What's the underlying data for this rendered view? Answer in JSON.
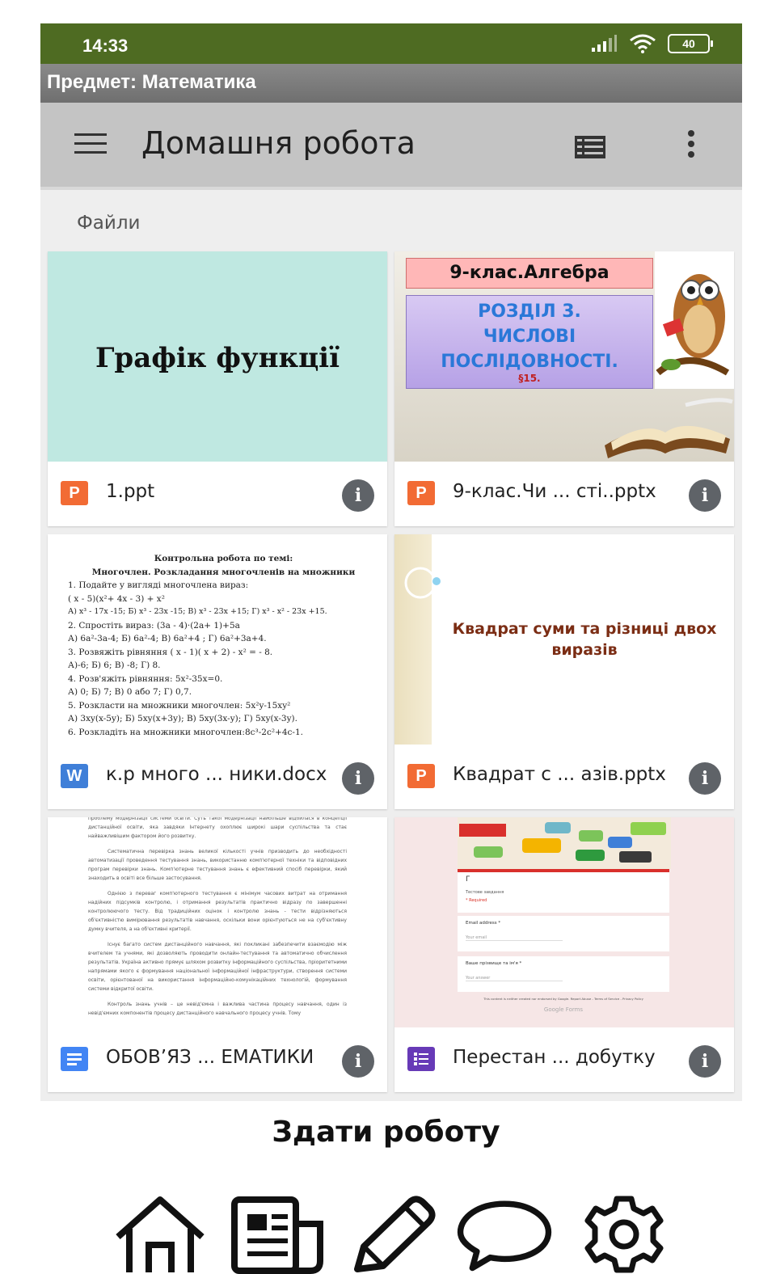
{
  "status": {
    "time": "14:33",
    "battery": "40"
  },
  "subject": "Предмет: Математика",
  "appbar": {
    "title": "Домашня робота"
  },
  "section_label": "Файли",
  "files": [
    {
      "name": "1.ppt",
      "type": "P",
      "thumb_title": "Графік функції"
    },
    {
      "name": "9-клас.Чи ... сті..pptx",
      "type": "P",
      "thumb_banner": "9-клас.Алгебра",
      "thumb_lines": [
        "РОЗДІЛ 3.",
        "ЧИСЛОВІ",
        "ПОСЛІДОВНОСТІ."
      ],
      "thumb_par": "§15."
    },
    {
      "name": "к.р много ... ники.docx",
      "type": "W",
      "thumb_heading1": "Контрольна робота по темі:",
      "thumb_heading2": "Многочлен. Розкладання многочленів на множники",
      "thumb_lines": [
        "1. Подайте у вигляді многочлена вираз:",
        "( x - 5)(x²+ 4x - 3) + x²",
        "А) x³ - 17x -15; Б) x³ - 23x -15;  В) x³ - 23x +15; Г) x³ - x² - 23x +15.",
        "2. Спростіть вираз: (3a - 4)·(2a+ 1)+5a",
        "А) 6a²-3a-4; Б) 6a²-4;  В) 6a²+4 ;  Г) 6a²+3a+4.",
        "3. Розвяжіть рівняння ( x - 1)( x + 2) - x² = - 8.",
        "А)-6;   Б) 6;  В)  -8;  Г) 8.",
        "4. Розв'яжіть рівняння:  5x²-35x=0.",
        "А) 0;  Б)  7;  В)  0 або 7;   Г) 0,7.",
        "5. Розкласти на множники многочлен: 5x²y-15xy²",
        "А)  3xy(x-5y); Б) 5xy(x+3y); В) 5xy(3x-y); Г) 5xy(x-3y).",
        "6. Розкладіть на множники многочлен:8c³-2c²+4c-1."
      ]
    },
    {
      "name": "Квадрат с ... азів.pptx",
      "type": "P",
      "thumb_title": "Квадрат суми та різниці двох виразів"
    },
    {
      "name": "ОБОВ’ЯЗ ... ЕМАТИКИ",
      "type": "docs",
      "thumb_paragraphs": [
        "проблему модернізації системи освіти. Суть такої модернізації найбільше відбилася в концепції дистанційної освіти, яка завдяки Інтернету охоплює широкі шари суспільства та стає найважливішим фактором його розвитку.",
        "Систематична перевірка знань великої кількості учнів призводить до необхідності автоматизації проведення тестування знань, використанню комп'ютерної техніки та відповідних програм перевірки знань. Комп'ютерне тестування знань є ефективний спосіб перевірки, який знаходить в освіті все більше застосування.",
        "Однією з переваг комп'ютерного тестування є мінімум часових витрат на отримання надійних підсумків контролю, і отримання результатів практично відразу по завершенні контролюючого тесту. Від традиційних оцінок і контролю знань - тести відрізняються об'єктивністю вимірювання результатів навчання, оскільки вони орієнтуються не на суб'єктивну думку вчителя, а на об'єктивні критерії.",
        "Існує багато систем дистанційного навчання, які покликані забезпечити взаємодію між вчителем та учнями, які дозволяють проводити онлайн-тестування та автоматично обчислення результатів. Україна активно прямує шляхом розвитку інформаційного суспільства, пріоритетними напрямами якого є формування національної інформаційної інфраструктури, створення системи освіти, орієнтованої на використання інформаційно-комунікаційних технологій, формування системи відкритої освіти.",
        "Контроль знань учнів – це невід'ємна і важлива частина процесу навчання, один із невід'ємних компонентів процесу дистанційного навчального процесу учнів. Тому"
      ]
    },
    {
      "name": "Перестан ... добутку",
      "type": "forms",
      "thumb_form": {
        "title": "Г",
        "desc": "Тестове завдання",
        "required": "* Required",
        "q1": "Email address *",
        "q1_hint": "Your email",
        "q2": "Ваше прізвище та ім'я *",
        "q2_hint": "Your answer",
        "footer": "This content is neither created nor endorsed by Google. Report Abuse - Terms of Service - Privacy Policy",
        "brand": "Google Forms"
      }
    }
  ],
  "submit_label": "Здати роботу",
  "bottom_nav": [
    "home-icon",
    "newspaper-icon",
    "pencil-icon",
    "chat-icon",
    "settings-icon"
  ],
  "colors": {
    "status": "#4e6b22",
    "ppt": "#f26b34",
    "word": "#3f7fd8",
    "docs": "#4285f4",
    "forms": "#673ab7",
    "thumb1_bg": "#bfe8e1"
  }
}
